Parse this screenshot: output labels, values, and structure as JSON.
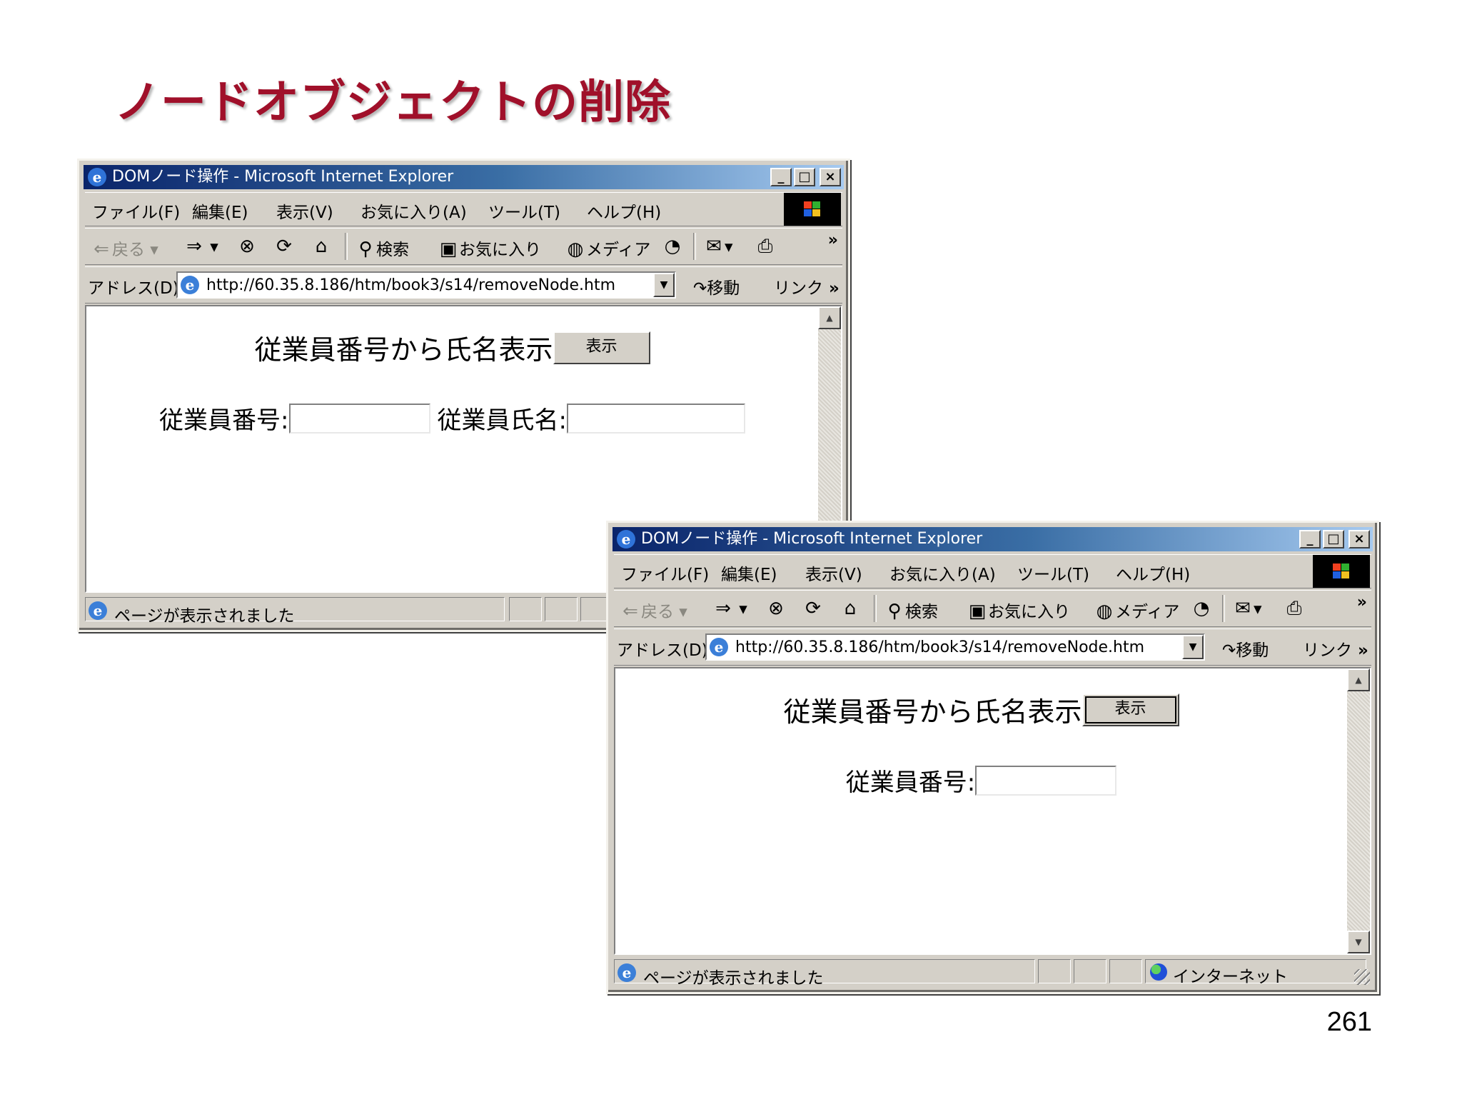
{
  "slide": {
    "title": "ノードオブジェクトの削除",
    "page_number": "261"
  },
  "window": {
    "title": "DOMノード操作 - Microsoft Internet Explorer",
    "app_icon": "ie-icon",
    "minimize": "_",
    "maximize": "□",
    "close": "×"
  },
  "menu": [
    "ファイル(F)",
    "編集(E)",
    "表示(V)",
    "お気に入り(A)",
    "ツール(T)",
    "ヘルプ(H)"
  ],
  "toolbar": {
    "back": "戻る",
    "forward_icon": "arrow-right-icon",
    "stop_icon": "stop-icon",
    "refresh_icon": "refresh-icon",
    "home_icon": "home-icon",
    "search": "検索",
    "favorites": "お気に入り",
    "media": "メディア",
    "history_icon": "history-icon",
    "mail_icon": "mail-icon",
    "print_icon": "print-icon",
    "more": "»"
  },
  "address": {
    "label": "アドレス(D)",
    "url": "http://60.35.8.186/htm/book3/s14/removeNode.htm",
    "go": "移動",
    "links": "リンク"
  },
  "page": {
    "heading": "従業員番号から氏名表示",
    "button_label": "表示",
    "employee_number_label": "従業員番号:",
    "employee_name_label": "従業員氏名:"
  },
  "status": {
    "text": "ページが表示されました",
    "zone": "インターネット"
  },
  "colors": {
    "title_red": "#a0102a",
    "titlebar_start": "#0a246a",
    "titlebar_end": "#a6caf0",
    "chrome_gray": "#d4d0c8"
  }
}
